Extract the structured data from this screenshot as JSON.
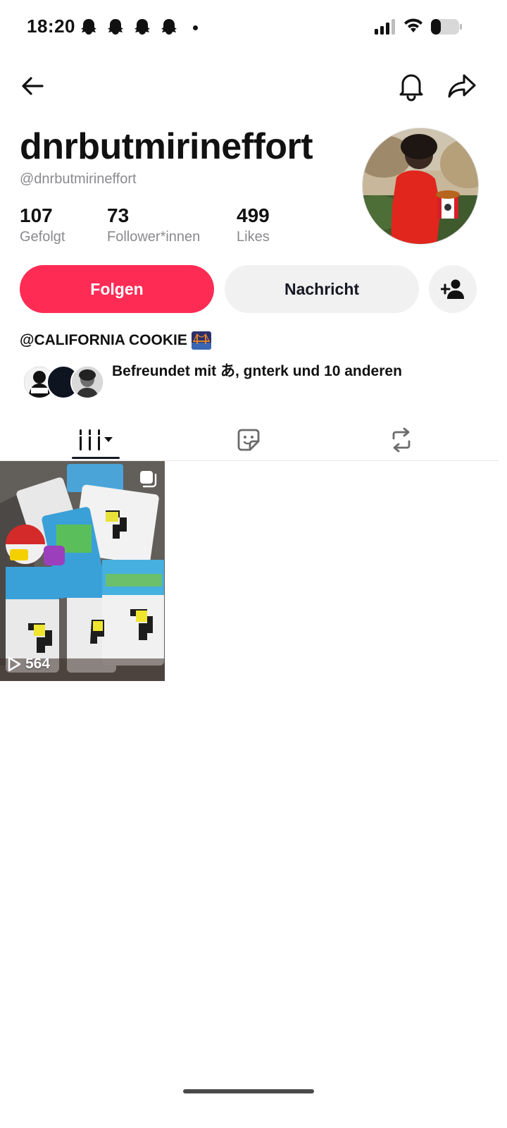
{
  "status": {
    "time": "18:20",
    "icons": [
      "snapchat-ghost-icon",
      "snapchat-ghost-icon",
      "snapchat-ghost-icon",
      "snapchat-ghost-icon",
      "dot-icon",
      "cellular-signal-icon",
      "wifi-icon",
      "battery-icon"
    ]
  },
  "nav": {
    "back_icon": "arrow-left-icon",
    "bell_icon": "bell-icon",
    "share_icon": "share-arrow-icon"
  },
  "profile": {
    "display_name": "dnrbutmirineffort",
    "handle": "@dnrbutmirineffort",
    "stats": [
      {
        "value": "107",
        "label": "Gefolgt"
      },
      {
        "value": "73",
        "label": "Follower*innen"
      },
      {
        "value": "499",
        "label": "Likes"
      }
    ]
  },
  "actions": {
    "follow": "Folgen",
    "message": "Nachricht",
    "add_friend_icon": "person-add-icon"
  },
  "bio": {
    "text": "@CALIFORNIA COOKIE",
    "emoji_icon": "bridge-at-night-icon"
  },
  "friends": {
    "text": "Befreundet mit あ, gnterk und 10 anderen"
  },
  "tabs": [
    {
      "name": "videos",
      "icon": "grid-bars-icon",
      "active": true
    },
    {
      "name": "stickers",
      "icon": "sticker-icon",
      "active": false
    },
    {
      "name": "reposts",
      "icon": "repost-icon",
      "active": false
    }
  ],
  "videos": [
    {
      "views": "564",
      "play_icon": "play-icon",
      "multi_icon": "multi-image-icon"
    }
  ],
  "colors": {
    "accent": "#fe2c55",
    "secondary_button": "#f1f1f2",
    "muted_text": "#8a8a8e"
  }
}
